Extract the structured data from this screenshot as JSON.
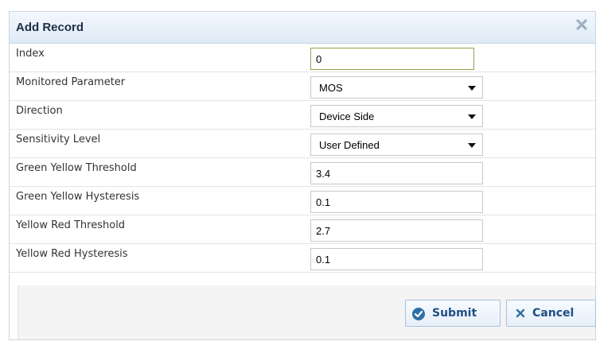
{
  "dialog": {
    "title": "Add Record",
    "close_icon": "close-icon",
    "fields": [
      {
        "label": "Index",
        "value": "0",
        "type": "text"
      },
      {
        "label": "Monitored Parameter",
        "value": "MOS",
        "type": "select"
      },
      {
        "label": "Direction",
        "value": "Device Side",
        "type": "select"
      },
      {
        "label": "Sensitivity Level",
        "value": "User Defined",
        "type": "select"
      },
      {
        "label": "Green Yellow Threshold",
        "value": "3.4",
        "type": "text"
      },
      {
        "label": "Green Yellow Hysteresis",
        "value": "0.1",
        "type": "text"
      },
      {
        "label": "Yellow Red Threshold",
        "value": "2.7",
        "type": "text"
      },
      {
        "label": "Yellow Red Hysteresis",
        "value": "0.1",
        "type": "text"
      }
    ],
    "buttons": {
      "submit_label": "Submit",
      "submit_icon": "check-circle-icon",
      "cancel_label": "Cancel",
      "cancel_icon": "x-icon"
    }
  },
  "colors": {
    "title_text": "#1d2f47",
    "button_text": "#1f4f83",
    "focused_border": "#8aa84a"
  }
}
